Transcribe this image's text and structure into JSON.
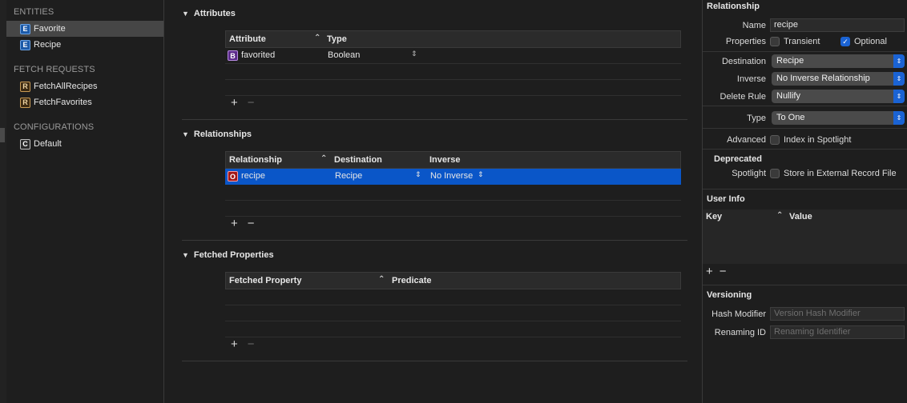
{
  "sidebar": {
    "sections": {
      "entities": "ENTITIES",
      "fetch_requests": "FETCH REQUESTS",
      "configurations": "CONFIGURATIONS"
    },
    "entities": [
      {
        "badge": "E",
        "label": "Favorite",
        "selected": true
      },
      {
        "badge": "E",
        "label": "Recipe",
        "selected": false
      }
    ],
    "fetch_requests": [
      {
        "badge": "R",
        "label": "FetchAllRecipes"
      },
      {
        "badge": "R",
        "label": "FetchFavorites"
      }
    ],
    "configurations": [
      {
        "badge": "C",
        "label": "Default"
      }
    ]
  },
  "attributes": {
    "title": "Attributes",
    "headers": {
      "attribute": "Attribute",
      "type": "Type"
    },
    "rows": [
      {
        "badge": "B",
        "name": "favorited",
        "type": "Boolean"
      }
    ]
  },
  "relationships": {
    "title": "Relationships",
    "headers": {
      "relationship": "Relationship",
      "destination": "Destination",
      "inverse": "Inverse"
    },
    "rows": [
      {
        "badge": "O",
        "name": "recipe",
        "destination": "Recipe",
        "inverse": "No Inverse"
      }
    ]
  },
  "fetched_properties": {
    "title": "Fetched Properties",
    "headers": {
      "fetched_property": "Fetched Property",
      "predicate": "Predicate"
    }
  },
  "inspector": {
    "title": "Relationship",
    "name_label": "Name",
    "name_value": "recipe",
    "properties_label": "Properties",
    "transient_label": "Transient",
    "transient_checked": false,
    "optional_label": "Optional",
    "optional_checked": true,
    "destination_label": "Destination",
    "destination_value": "Recipe",
    "inverse_label": "Inverse",
    "inverse_value": "No Inverse Relationship",
    "delete_rule_label": "Delete Rule",
    "delete_rule_value": "Nullify",
    "type_label": "Type",
    "type_value": "To One",
    "advanced_label": "Advanced",
    "index_spotlight_label": "Index in Spotlight",
    "deprecated_title": "Deprecated",
    "spotlight_label": "Spotlight",
    "store_external_label": "Store in External Record File",
    "user_info_title": "User Info",
    "user_info_headers": {
      "key": "Key",
      "value": "Value"
    },
    "versioning_title": "Versioning",
    "hash_modifier_label": "Hash Modifier",
    "hash_modifier_placeholder": "Version Hash Modifier",
    "renaming_id_label": "Renaming ID",
    "renaming_id_placeholder": "Renaming Identifier"
  },
  "glyphs": {
    "plus": "+",
    "minus": "−",
    "disclosure": "▼",
    "sort_up": "⌃",
    "updown": "⇕"
  },
  "colors": {
    "accent": "#1a63d4",
    "selection": "#0a56c8"
  }
}
